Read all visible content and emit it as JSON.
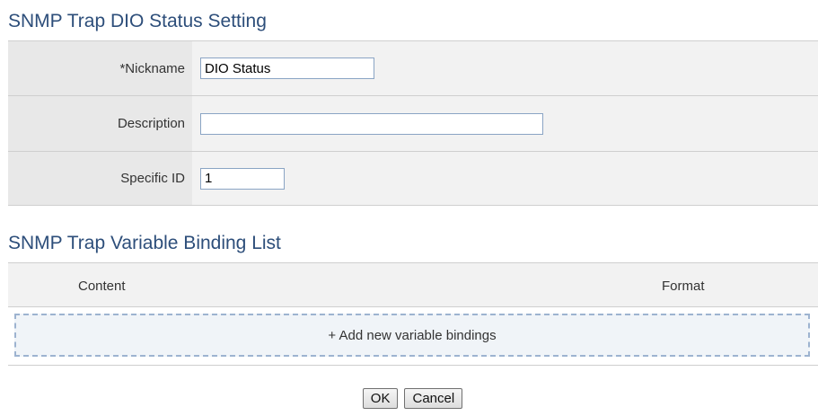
{
  "settings": {
    "title": "SNMP Trap DIO Status Setting",
    "nickname_label": "*Nickname",
    "nickname_value": "DIO Status",
    "description_label": "Description",
    "description_value": "",
    "specific_id_label": "Specific ID",
    "specific_id_value": "1"
  },
  "binding_list": {
    "title": "SNMP Trap Variable Binding List",
    "columns": [
      "Content",
      "Format"
    ],
    "add_label": "+ Add new variable bindings"
  },
  "actions": {
    "ok_label": "OK",
    "cancel_label": "Cancel"
  }
}
